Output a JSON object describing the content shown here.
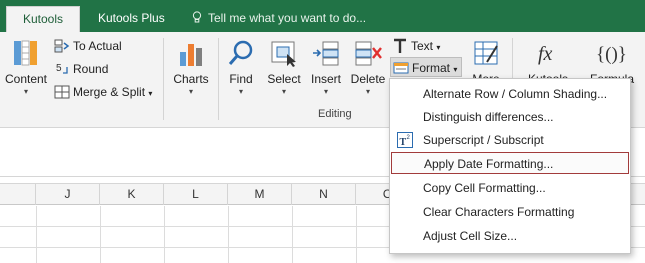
{
  "tabs": {
    "active": "Kutools ™",
    "second": "Kutools Plus",
    "tell_me": "Tell me what you want to do..."
  },
  "ribbon": {
    "content": "Content",
    "to_actual": "To Actual",
    "round": "Round",
    "merge_split": "Merge & Split",
    "charts": "Charts",
    "find": "Find",
    "select": "Select",
    "insert": "Insert",
    "delete": "Delete",
    "text": "Text",
    "format": "Format",
    "more": "More",
    "kutools": "Kutools",
    "formula": "Formula",
    "editing_group": "Editing"
  },
  "columns": [
    "J",
    "K",
    "L",
    "M",
    "N",
    "O"
  ],
  "format_menu": {
    "items": [
      "Alternate Row / Column Shading...",
      "Distinguish differences...",
      "Superscript / Subscript",
      "Apply Date Formatting...",
      "Copy Cell Formatting...",
      "Clear Characters Formatting",
      "Adjust Cell Size..."
    ],
    "highlighted": "Apply Date Formatting..."
  },
  "colors": {
    "tab_bar": "#217346",
    "ribbon_bg": "#f3f3f3",
    "highlight_border": "#a23b3b"
  }
}
